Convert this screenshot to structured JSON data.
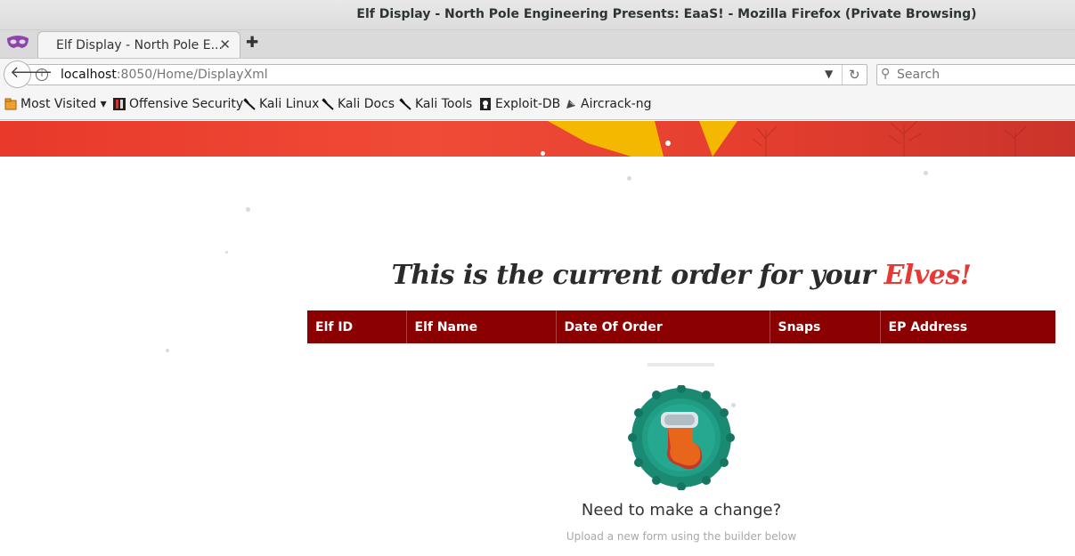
{
  "window": {
    "title": "Elf Display - North Pole Engineering Presents: EaaS! - Mozilla Firefox (Private Browsing)"
  },
  "tabs": [
    {
      "label": "Elf Display - North Pole E...",
      "close": "✕"
    }
  ],
  "newtab": "✚",
  "nav": {
    "url_host": "localhost",
    "url_path": ":8050/Home/DisplayXml",
    "search_placeholder": "Search"
  },
  "bookmarks": [
    {
      "label": "Most Visited ▾",
      "icon": "most-visited-icon"
    },
    {
      "label": "Offensive Security",
      "icon": "offsec-icon"
    },
    {
      "label": "Kali Linux",
      "icon": "kali-icon"
    },
    {
      "label": "Kali Docs",
      "icon": "kali-icon"
    },
    {
      "label": "Kali Tools",
      "icon": "kali-icon"
    },
    {
      "label": "Exploit-DB",
      "icon": "exploit-db-icon"
    },
    {
      "label": "Aircrack-ng",
      "icon": "aircrack-icon"
    }
  ],
  "page": {
    "heading_main": "This is the current order for your ",
    "heading_accent": "Elves!",
    "table_headers": [
      "Elf ID",
      "Elf Name",
      "Date Of Order",
      "Snaps",
      "EP Address"
    ],
    "change_title": "Need to make a change?",
    "change_sub": "Upload a new form using the builder below"
  },
  "colors": {
    "banner": "#e8392b",
    "table_header": "#8b0000",
    "accent": "#e53935",
    "wreath": "#1a8a72"
  }
}
